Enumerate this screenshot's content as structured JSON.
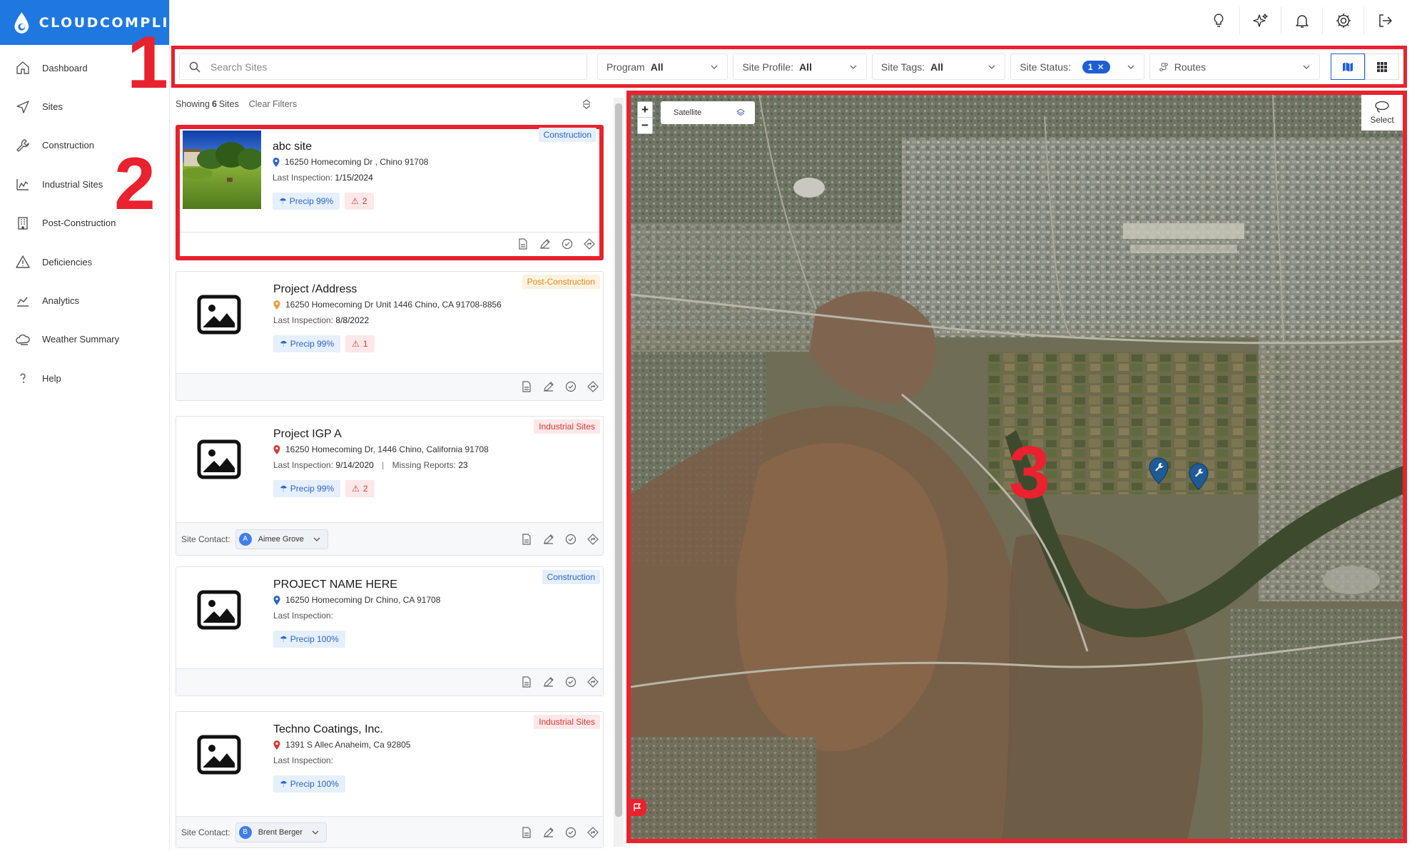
{
  "brand": {
    "name": "CLOUDCOMPLI"
  },
  "sidebar": {
    "items": [
      {
        "label": "Dashboard",
        "icon": "home-icon"
      },
      {
        "label": "Sites",
        "icon": "send-icon"
      },
      {
        "label": "Construction",
        "icon": "wrench-icon"
      },
      {
        "label": "Industrial Sites",
        "icon": "factory-icon"
      },
      {
        "label": "Post-Construction",
        "icon": "building-icon"
      },
      {
        "label": "Deficiencies",
        "icon": "warning-icon"
      },
      {
        "label": "Analytics",
        "icon": "chart-icon"
      },
      {
        "label": "Weather Summary",
        "icon": "cloud-icon"
      },
      {
        "label": "Help",
        "icon": "help-icon"
      }
    ]
  },
  "topbar": {
    "icons": [
      "lightbulb-icon",
      "sparkle-icon",
      "bell-icon",
      "gear-icon",
      "logout-icon"
    ]
  },
  "filters": {
    "search_placeholder": "Search Sites",
    "program_label": "Program",
    "program_value": "All",
    "profile_label": "Site Profile:",
    "profile_value": "All",
    "tags_label": "Site Tags:",
    "tags_value": "All",
    "status_label": "Site Status:",
    "status_count": "1",
    "routes_label": "Routes"
  },
  "annotations": {
    "one": "1",
    "two": "2",
    "three": "3"
  },
  "list": {
    "showing_prefix": "Showing",
    "showing_count": "6",
    "showing_suffix": "Sites",
    "clear_filters": "Clear Filters",
    "inspection_label": "Last Inspection:",
    "missing_label": "Missing Reports:",
    "contact_label": "Site Contact:",
    "sites": [
      {
        "name": "abc site",
        "address": "16250 Homecoming Dr , Chino 91708",
        "last_inspection": "1/15/2024",
        "precip": "Precip 99%",
        "deficiencies": "2",
        "type": "Construction"
      },
      {
        "name": "Project /Address",
        "address": "16250 Homecoming Dr Unit 1446 Chino, CA 91708-8856",
        "last_inspection": "8/8/2022",
        "precip": "Precip 99%",
        "deficiencies": "1",
        "type": "Post-Construction"
      },
      {
        "name": "Project IGP A",
        "address": "16250 Homecoming Dr, 1446 Chino, California 91708",
        "last_inspection": "9/14/2020",
        "missing_reports": "23",
        "precip": "Precip 99%",
        "deficiencies": "2",
        "type": "Industrial Sites",
        "contact_initial": "A",
        "contact_name": "Aimee Grove"
      },
      {
        "name": "PROJECT NAME HERE",
        "address": "16250 Homecoming Dr Chino, CA 91708",
        "last_inspection": "",
        "precip": "Precip 100%",
        "type": "Construction"
      },
      {
        "name": "Techno Coatings, Inc.",
        "address": "1391 S Allec Anaheim, Ca 92805",
        "last_inspection": "",
        "precip": "Precip 100%",
        "type": "Industrial Sites",
        "contact_initial": "B",
        "contact_name": "Brent Berger"
      }
    ]
  },
  "map": {
    "layer": "Satellite",
    "select_label": "Select",
    "zoom_in": "+",
    "zoom_out": "−"
  },
  "colors": {
    "brand": "#1f78e0",
    "annotation": "#e8222e",
    "construction": "#2a66c9",
    "post_construction": "#e08a1a",
    "industrial": "#d43a3a"
  }
}
